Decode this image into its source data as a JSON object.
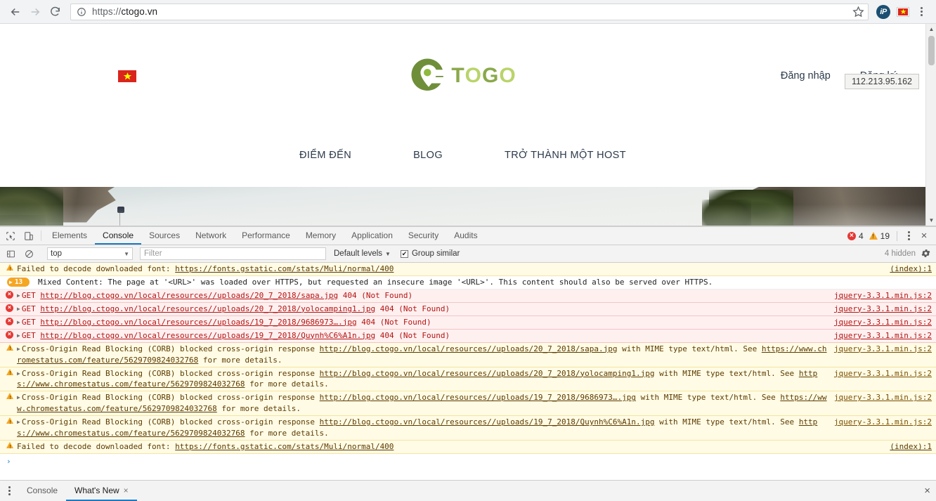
{
  "browser": {
    "back_label": "Back",
    "forward_label": "Forward",
    "reload_label": "Reload",
    "url_scheme": "https://",
    "url_host": "ctogo.vn",
    "url_full": "https://ctogo.vn",
    "bookmark_label": "Bookmark this page",
    "extensions": [
      {
        "name": "ip-extension-icon",
        "label": "iP"
      },
      {
        "name": "vietnam-flag-extension-icon",
        "label": "VN"
      }
    ],
    "menu_label": "Customize and control Google Chrome"
  },
  "page": {
    "locale_flag": "Vietnam",
    "logo": {
      "t1": "T",
      "t2": "O",
      "t3": "G",
      "t4": "O",
      "full": "CTOGO"
    },
    "auth": [
      {
        "label": "Đăng nhập"
      },
      {
        "label": "Đăng ký"
      }
    ],
    "nav": [
      {
        "label": "ĐIỂM ĐẾN"
      },
      {
        "label": "BLOG"
      },
      {
        "label": "TRỞ THÀNH MỘT HOST"
      }
    ],
    "ip_tooltip": "112.213.95.162"
  },
  "devtools": {
    "tabs": [
      {
        "label": "Elements",
        "active": false
      },
      {
        "label": "Console",
        "active": true
      },
      {
        "label": "Sources",
        "active": false
      },
      {
        "label": "Network",
        "active": false
      },
      {
        "label": "Performance",
        "active": false
      },
      {
        "label": "Memory",
        "active": false
      },
      {
        "label": "Application",
        "active": false
      },
      {
        "label": "Security",
        "active": false
      },
      {
        "label": "Audits",
        "active": false
      }
    ],
    "error_count": "4",
    "warning_count": "19",
    "close_label": "×",
    "filterbar": {
      "context": "top",
      "filter_placeholder": "Filter",
      "filter_value": "",
      "levels_label": "Default levels",
      "group_similar_label": "Group similar",
      "group_similar_checked": true,
      "hidden_label": "4 hidden",
      "settings_label": "Settings"
    },
    "messages": [
      {
        "level": "warning",
        "text_before": "Failed to decode downloaded font: ",
        "link": "https://fonts.gstatic.com/stats/Muli/normal/400",
        "text_after": "",
        "source": "(index):1",
        "expandable": false
      },
      {
        "level": "group",
        "badge": "13",
        "text_before": "Mixed Content: The page at '<URL>' was loaded over HTTPS, but requested an insecure image '<URL>'. This content should also be served over HTTPS.",
        "link": "",
        "text_after": "",
        "source": "",
        "expandable": false
      },
      {
        "level": "error",
        "method": "GET",
        "text_before": "",
        "link": "http://blog.ctogo.vn/local/resources//uploads/20_7_2018/sapa.jpg",
        "text_after": " 404 (Not Found)",
        "status": "404 (Not Found)",
        "source": "jquery-3.3.1.min.js:2",
        "expandable": true
      },
      {
        "level": "error",
        "method": "GET",
        "text_before": "",
        "link": "http://blog.ctogo.vn/local/resources//uploads/20_7_2018/yolocamping1.jpg",
        "text_after": " 404 (Not Found)",
        "status": "404 (Not Found)",
        "source": "jquery-3.3.1.min.js:2",
        "expandable": true
      },
      {
        "level": "error",
        "method": "GET",
        "text_before": "",
        "link": "http://blog.ctogo.vn/local/resources//uploads/19_7_2018/9686973….jpg",
        "text_after": " 404 (Not Found)",
        "status": "404 (Not Found)",
        "source": "jquery-3.3.1.min.js:2",
        "expandable": true
      },
      {
        "level": "error",
        "method": "GET",
        "text_before": "",
        "link": "http://blog.ctogo.vn/local/resources//uploads/19_7_2018/Quynh%C6%A1n.jpg",
        "text_after": " 404 (Not Found)",
        "status": "404 (Not Found)",
        "source": "jquery-3.3.1.min.js:2",
        "expandable": true
      },
      {
        "level": "warning",
        "text_before": "Cross-Origin Read Blocking (CORB) blocked cross-origin response ",
        "link": "http://blog.ctogo.vn/local/resources//uploads/20_7_2018/sapa.jpg",
        "text_mid": " with MIME type text/html. See ",
        "link2": "https://www.chromestatus.com/feature/5629709824032768",
        "text_after": " for more details.",
        "source": "jquery-3.3.1.min.js:2",
        "expandable": true
      },
      {
        "level": "warning",
        "text_before": "Cross-Origin Read Blocking (CORB) blocked cross-origin response ",
        "link": "http://blog.ctogo.vn/local/resources//uploads/20_7_2018/yolocamping1.jpg",
        "text_mid": " with MIME type text/html. See ",
        "link2": "https://www.chromestatus.com/feature/5629709824032768",
        "text_after": " for more details.",
        "source": "jquery-3.3.1.min.js:2",
        "expandable": true
      },
      {
        "level": "warning",
        "text_before": "Cross-Origin Read Blocking (CORB) blocked cross-origin response ",
        "link": "http://blog.ctogo.vn/local/resources//uploads/19_7_2018/9686973….jpg",
        "text_mid": " with MIME type text/html. See ",
        "link2": "https://www.chromestatus.com/feature/5629709824032768",
        "text_after": " for more details.",
        "source": "jquery-3.3.1.min.js:2",
        "expandable": true
      },
      {
        "level": "warning",
        "text_before": "Cross-Origin Read Blocking (CORB) blocked cross-origin response ",
        "link": "http://blog.ctogo.vn/local/resources//uploads/19_7_2018/Quynh%C6%A1n.jpg",
        "text_mid": " with MIME type text/html. See ",
        "link2": "https://www.chromestatus.com/feature/5629709824032768",
        "text_after": " for more details.",
        "source": "jquery-3.3.1.min.js:2",
        "expandable": true
      },
      {
        "level": "warning",
        "text_before": "Failed to decode downloaded font: ",
        "link": "https://fonts.gstatic.com/stats/Muli/normal/400",
        "text_after": "",
        "source": "(index):1",
        "expandable": false
      }
    ],
    "prompt_caret": "›"
  },
  "drawer": {
    "tabs": [
      {
        "label": "Console",
        "active": false,
        "closable": false
      },
      {
        "label": "What's New",
        "active": true,
        "closable": true
      }
    ],
    "close_label": "×"
  },
  "colors": {
    "accent_blue": "#1a7bc4",
    "error_red": "#e53935",
    "warning_amber": "#f5a623",
    "logo_green_dark": "#8aa84a",
    "logo_green_light": "#b9d46a",
    "flag_red": "#da251d",
    "flag_star": "#ffff00"
  }
}
